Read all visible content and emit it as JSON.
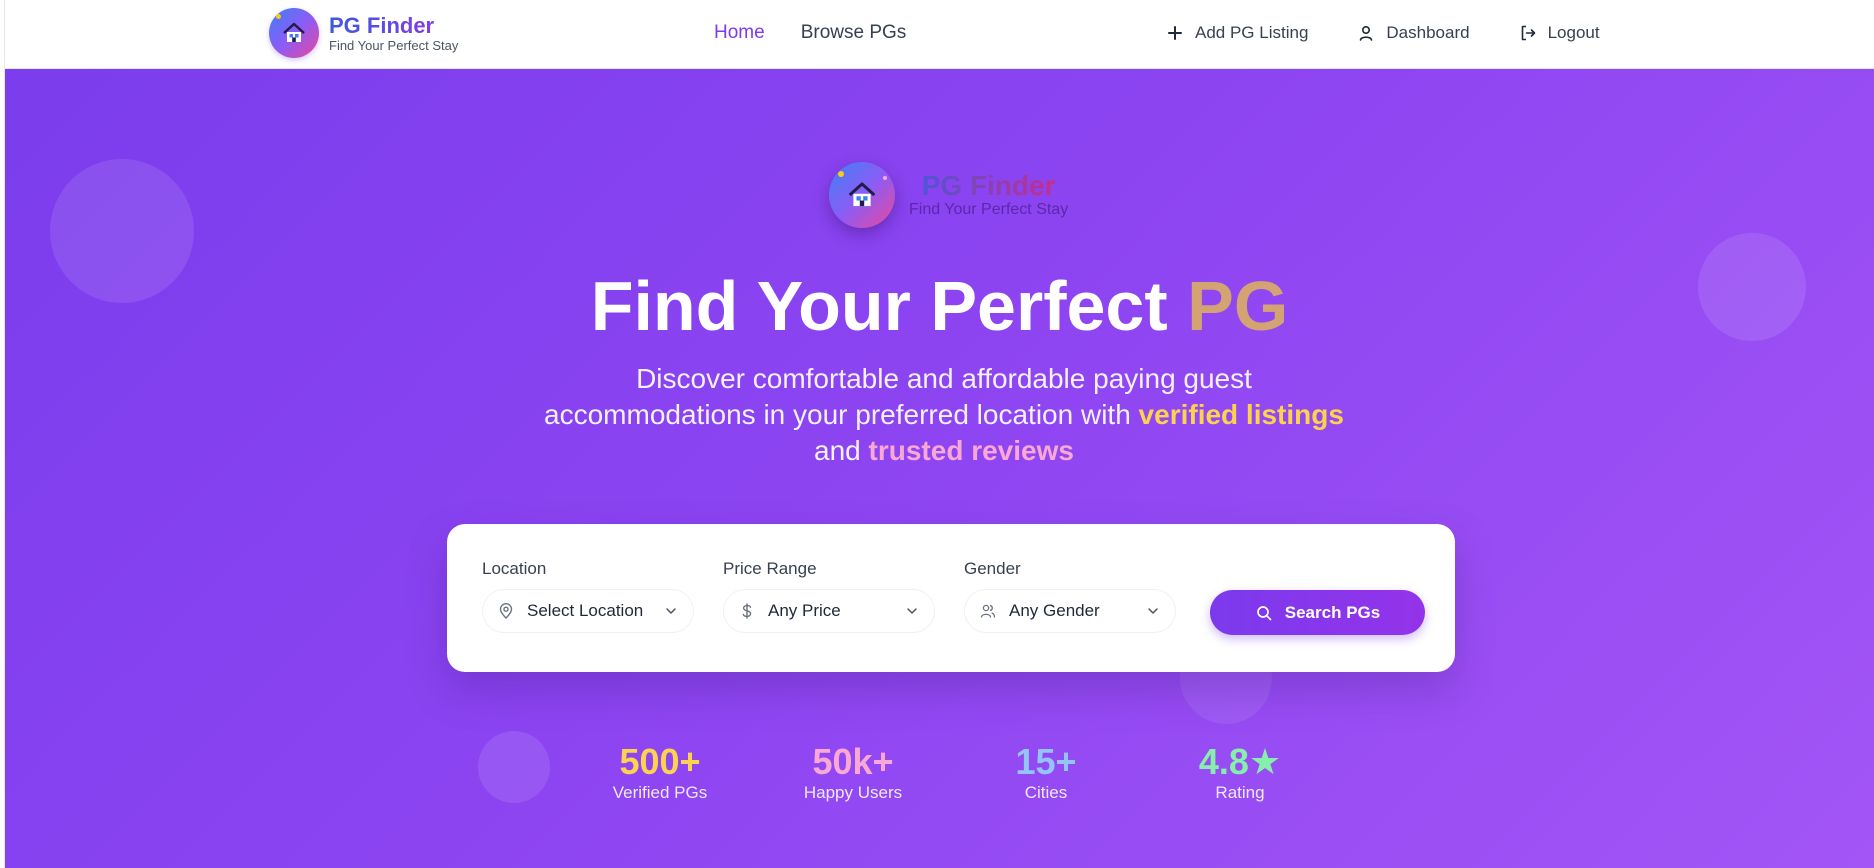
{
  "brand": {
    "name": "PG Finder",
    "tagline": "Find Your Perfect Stay"
  },
  "nav": {
    "links": [
      {
        "label": "Home",
        "active": true
      },
      {
        "label": "Browse PGs",
        "active": false
      }
    ],
    "actions": [
      {
        "label": "Add PG Listing",
        "icon": "plus-icon"
      },
      {
        "label": "Dashboard",
        "icon": "user-icon"
      },
      {
        "label": "Logout",
        "icon": "logout-icon"
      }
    ]
  },
  "hero": {
    "brand_name": "PG Finder",
    "brand_tagline": "Find Your Perfect Stay",
    "title_main": "Find Your Perfect ",
    "title_accent": "PG",
    "subtitle_part1": "Discover comfortable and affordable paying guest accommodations in your preferred location with ",
    "subtitle_highlight1": "verified listings",
    "subtitle_part2": " and ",
    "subtitle_highlight2": "trusted reviews"
  },
  "search": {
    "fields": [
      {
        "label": "Location",
        "value": "Select Location",
        "icon": "location-pin-icon"
      },
      {
        "label": "Price Range",
        "value": "Any Price",
        "icon": "dollar-icon"
      },
      {
        "label": "Gender",
        "value": "Any Gender",
        "icon": "users-icon"
      }
    ],
    "button_label": "Search PGs"
  },
  "stats": [
    {
      "value": "500+",
      "label": "Verified PGs",
      "color": "#fcd34d"
    },
    {
      "value": "50k+",
      "label": "Happy Users",
      "color": "#f9a8d4"
    },
    {
      "value": "15+",
      "label": "Cities",
      "color": "#93c5fd"
    },
    {
      "value": "4.8★",
      "label": "Rating",
      "color": "#86efac"
    }
  ],
  "colors": {
    "accent": "#7c3aed",
    "hero_gradient_start": "#7b3ded",
    "hero_gradient_end": "#a355f6",
    "title_accent": "#d4a373"
  }
}
